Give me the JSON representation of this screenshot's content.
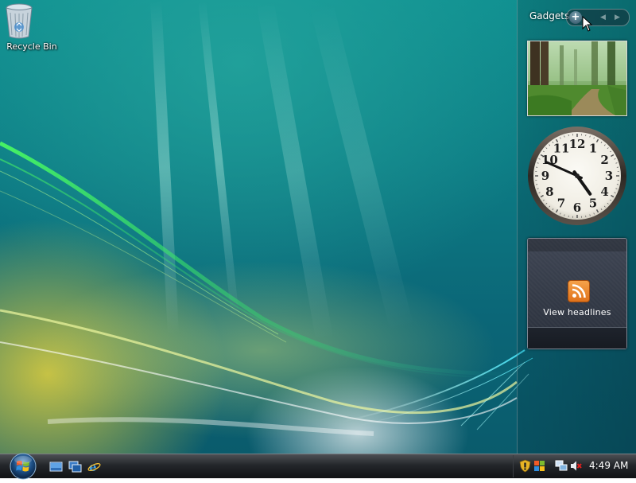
{
  "desktop": {
    "icons": [
      {
        "label": "Recycle Bin",
        "icon": "recycle-bin-icon"
      }
    ]
  },
  "sidebar": {
    "title": "Gadgets",
    "add_icon": "plus-icon",
    "prev_icon": "chevron-left-icon",
    "next_icon": "chevron-right-icon"
  },
  "gadgets": {
    "slideshow": {
      "image": "forest-path-photo"
    },
    "clock": {
      "numerals": [
        "12",
        "1",
        "2",
        "3",
        "4",
        "5",
        "6",
        "7",
        "8",
        "9",
        "10",
        "11"
      ],
      "time": {
        "hour": 4,
        "minute": 49,
        "second": 0
      }
    },
    "feed": {
      "icon": "rss-feed-icon",
      "link_text": "View headlines"
    }
  },
  "taskbar": {
    "start_icon": "windows-start-orb-icon",
    "quick_launch": [
      "show-desktop-icon",
      "switch-windows-icon",
      "internet-explorer-icon"
    ],
    "tray_icons": [
      "security-shield-icon",
      "windows-update-icon",
      "network-icon",
      "volume-muted-icon"
    ],
    "clock": "4:49 AM"
  },
  "colors": {
    "wallpaper_teal": "#0d7d85",
    "wallpaper_yellow": "#e6d23c",
    "taskbar": "#24272b",
    "feed_orange": "#e0721b"
  }
}
